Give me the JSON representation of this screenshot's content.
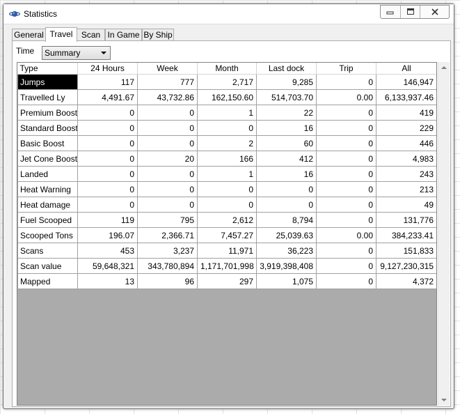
{
  "window": {
    "title": "Statistics"
  },
  "tabs": [
    {
      "label": "General"
    },
    {
      "label": "Travel"
    },
    {
      "label": "Scan"
    },
    {
      "label": "In Game"
    },
    {
      "label": "By Ship"
    }
  ],
  "active_tab": "Travel",
  "filter": {
    "label": "Time",
    "selected": "Summary"
  },
  "table": {
    "headers": [
      "Type",
      "24 Hours",
      "Week",
      "Month",
      "Last dock",
      "Trip",
      "All"
    ],
    "rows": [
      [
        "Jumps",
        "117",
        "777",
        "2,717",
        "9,285",
        "0",
        "146,947"
      ],
      [
        "Travelled Ly",
        "4,491.67",
        "43,732.86",
        "162,150.60",
        "514,703.70",
        "0.00",
        "6,133,937.46"
      ],
      [
        "Premium Boost",
        "0",
        "0",
        "1",
        "22",
        "0",
        "419"
      ],
      [
        "Standard Boost",
        "0",
        "0",
        "0",
        "16",
        "0",
        "229"
      ],
      [
        "Basic Boost",
        "0",
        "0",
        "2",
        "60",
        "0",
        "446"
      ],
      [
        "Jet Cone Boost",
        "0",
        "20",
        "166",
        "412",
        "0",
        "4,983"
      ],
      [
        "Landed",
        "0",
        "0",
        "1",
        "16",
        "0",
        "243"
      ],
      [
        "Heat Warning",
        "0",
        "0",
        "0",
        "0",
        "0",
        "213"
      ],
      [
        "Heat damage",
        "0",
        "0",
        "0",
        "0",
        "0",
        "49"
      ],
      [
        "Fuel Scooped",
        "119",
        "795",
        "2,612",
        "8,794",
        "0",
        "131,776"
      ],
      [
        "Scooped Tons",
        "196.07",
        "2,366.71",
        "7,457.27",
        "25,039.63",
        "0.00",
        "384,233.41"
      ],
      [
        "Scans",
        "453",
        "3,237",
        "11,971",
        "36,223",
        "0",
        "151,833"
      ],
      [
        "Scan value",
        "59,648,321",
        "343,780,894",
        "1,171,701,998",
        "3,919,398,408",
        "0",
        "9,127,230,315"
      ],
      [
        "Mapped",
        "13",
        "96",
        "297",
        "1,075",
        "0",
        "4,372"
      ]
    ],
    "selected_row": 0
  },
  "icons": {
    "app": "planet-icon",
    "minimize": "minimize-icon",
    "maximize": "maximize-icon",
    "close": "close-icon",
    "dropdown": "chevron-down-icon",
    "scroll_up": "scroll-up-icon",
    "scroll_down": "scroll-down-icon"
  }
}
